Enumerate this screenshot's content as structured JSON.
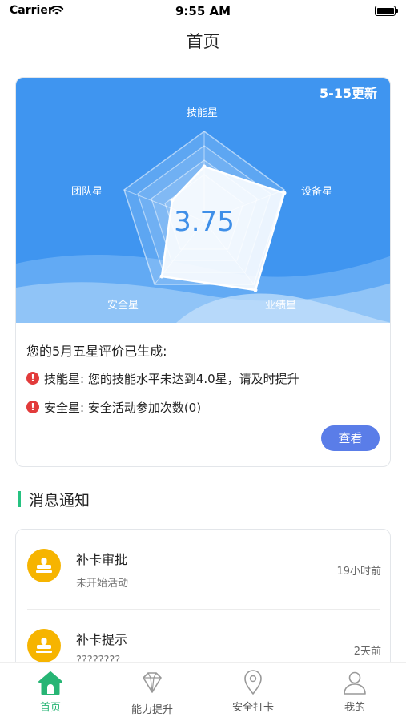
{
  "status_bar": {
    "carrier": "Carrier",
    "time": "9:55 AM"
  },
  "nav": {
    "title": "首页"
  },
  "score_card": {
    "update_label": "5-15更新",
    "score": "3.75",
    "radar_axes": [
      "技能星",
      "设备星",
      "业绩星",
      "安全星",
      "团队星"
    ],
    "eval_title": "您的5月五星评价已生成:",
    "alerts": [
      "技能星: 您的技能水平未达到4.0星，请及时提升",
      "安全星: 安全活动参加次数(0)"
    ],
    "view_button": "查看",
    "colors": {
      "banner": "#3f95f0",
      "score_text": "#3f8fe8",
      "alert": "#e23b3b",
      "button": "#5a7de8"
    }
  },
  "messages": {
    "section_title": "消息通知",
    "items": [
      {
        "title": "补卡审批",
        "subtitle": "未开始活动",
        "time": "19小时前",
        "icon": "stamp-icon"
      },
      {
        "title": "补卡提示",
        "subtitle": "????????",
        "time": "2天前",
        "icon": "stamp-icon"
      }
    ]
  },
  "tab_bar": {
    "active_color": "#26b574",
    "items": [
      {
        "label": "首页",
        "icon": "home-icon",
        "active": true
      },
      {
        "label": "能力提升",
        "icon": "diamond-icon",
        "active": false
      },
      {
        "label": "安全打卡",
        "icon": "location-icon",
        "active": false
      },
      {
        "label": "我的",
        "icon": "user-icon",
        "active": false
      }
    ]
  }
}
